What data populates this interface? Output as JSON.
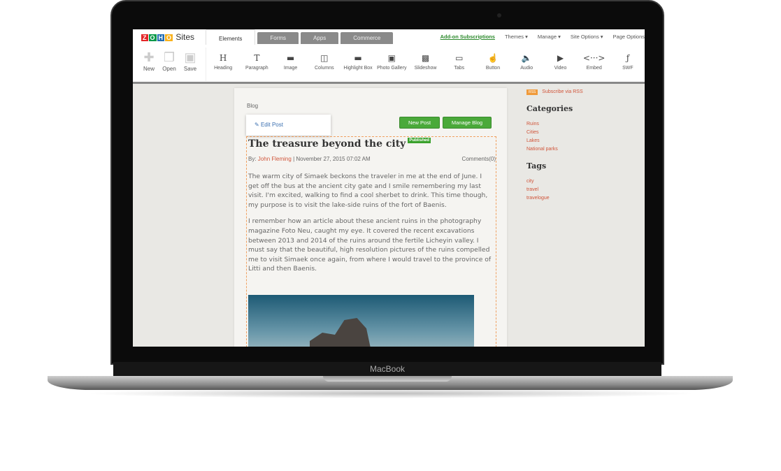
{
  "device_label": "MacBook",
  "app": {
    "logo": "ZOHO",
    "name": "Sites"
  },
  "file_buttons": [
    {
      "label": "New",
      "icon": "plus-icon"
    },
    {
      "label": "Open",
      "icon": "open-icon"
    },
    {
      "label": "Save",
      "icon": "save-icon"
    }
  ],
  "tabs": [
    "Elements",
    "Forms",
    "Apps",
    "Commerce"
  ],
  "menus": [
    "Add-on Subscriptions",
    "Themes ▾",
    "Manage ▾",
    "Site Options ▾",
    "Page Options"
  ],
  "elements": [
    {
      "label": "Heading",
      "glyph": "H"
    },
    {
      "label": "Paragraph",
      "glyph": "T"
    },
    {
      "label": "Image",
      "glyph": "▬"
    },
    {
      "label": "Columns",
      "glyph": "◫"
    },
    {
      "label": "Highlight Box",
      "glyph": "▬"
    },
    {
      "label": "Photo Gallery",
      "glyph": "▣"
    },
    {
      "label": "Slideshow",
      "glyph": "▩"
    },
    {
      "label": "Tabs",
      "glyph": "▭"
    },
    {
      "label": "Button",
      "glyph": "☝"
    },
    {
      "label": "Audio",
      "glyph": "🔈"
    },
    {
      "label": "Video",
      "glyph": "▶"
    },
    {
      "label": "Embed",
      "glyph": "<···>"
    },
    {
      "label": "SWF",
      "glyph": "ƒ"
    }
  ],
  "blog": {
    "breadcrumb": "Blog",
    "edit_post": "Edit Post",
    "new_post": "New Post",
    "manage_blog": "Manage Blog",
    "title": "The treasure beyond the city",
    "status": "Published",
    "by": "By:",
    "author": "John Fleming",
    "date": "| November 27, 2015 07:02 AM",
    "comments": "Comments(0)",
    "paragraphs": [
      "The warm city of Simaek beckons the traveler in me at the end of June. I get off the bus at the ancient city gate and I smile remembering my last visit. I'm excited, walking to find a cool sherbet to drink. This time though, my purpose is to visit the lake-side ruins of the fort of Baenis.",
      "I remember how an article about these ancient ruins in the photography magazine Foto Neu, caught my eye. It covered the recent excavations between 2013 and 2014 of the ruins around the fertile Licheyin valley. I must say that the beautiful, high resolution pictures of the ruins compelled me to visit Simaek once again, from where I would travel to the province of Litti and then Baenis."
    ]
  },
  "sidebar": {
    "rss_icon": "RSS",
    "rss": "Subscribe via RSS",
    "categories_title": "Categories",
    "categories": [
      "Ruins",
      "Cities",
      "Lakes",
      "National parks"
    ],
    "tags_title": "Tags",
    "tags": [
      "city",
      "travel",
      "travelogue"
    ]
  }
}
